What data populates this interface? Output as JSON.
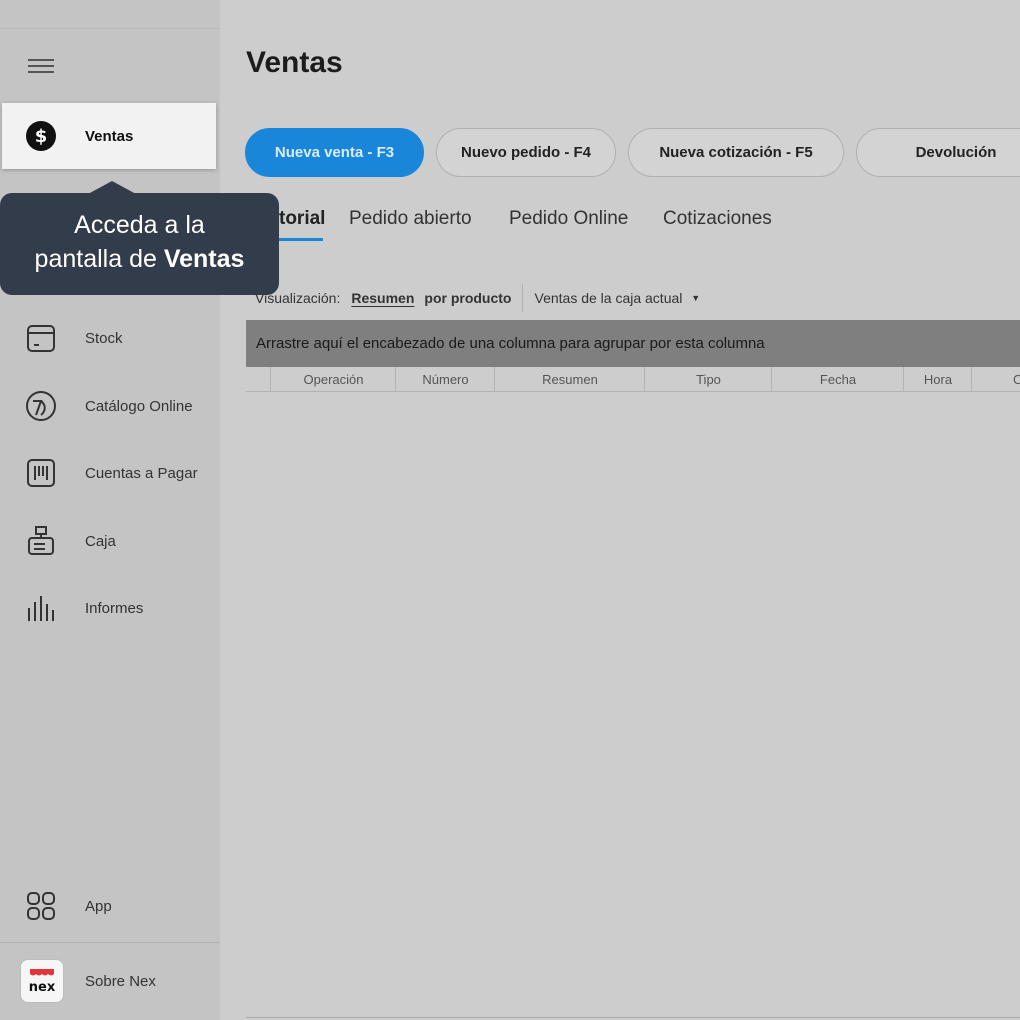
{
  "sidebar": {
    "items": [
      {
        "label": "Ventas",
        "icon": "dollar-circle-icon"
      },
      {
        "label": "Stock",
        "icon": "box-icon"
      },
      {
        "label": "Catálogo Online",
        "icon": "catalog-icon"
      },
      {
        "label": "Cuentas a Pagar",
        "icon": "barcode-icon"
      },
      {
        "label": "Caja",
        "icon": "cash-register-icon"
      },
      {
        "label": "Informes",
        "icon": "bar-chart-icon"
      },
      {
        "label": "App",
        "icon": "grid-icon"
      },
      {
        "label": "Sobre Nex",
        "icon": "nex-logo"
      }
    ],
    "logo_text": "nex"
  },
  "page": {
    "title": "Ventas"
  },
  "actions": [
    {
      "label": "Nueva venta - F3"
    },
    {
      "label": "Nuevo pedido - F4"
    },
    {
      "label": "Nueva cotización - F5"
    },
    {
      "label": "Devolución"
    }
  ],
  "tabs": [
    {
      "label": "torial"
    },
    {
      "label": "Pedido abierto"
    },
    {
      "label": "Pedido Online"
    },
    {
      "label": "Cotizaciones"
    }
  ],
  "visualization": {
    "label": "Visualización:",
    "options": [
      "Resumen",
      "por producto"
    ],
    "filter": "Ventas de la caja actual"
  },
  "grid": {
    "group_hint": "Arrastre aquí el encabezado de una columna para agrupar por esta columna",
    "columns": [
      "Operación",
      "Número",
      "Resumen",
      "Tipo",
      "Fecha",
      "Hora",
      "C"
    ]
  },
  "tooltip": {
    "line1": "Acceda a la",
    "line2_prefix": "pantalla de ",
    "line2_bold": "Ventas"
  },
  "colors": {
    "accent": "#1a86d9",
    "tooltip_bg": "#323c4a",
    "logo_red": "#e0353b"
  }
}
